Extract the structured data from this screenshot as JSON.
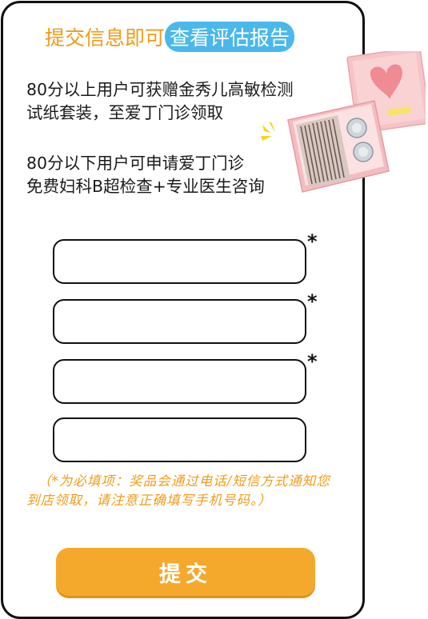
{
  "header": {
    "title_plain": "提交信息即可",
    "title_highlight": "查看评估报告"
  },
  "info": {
    "para1_line1": "80分以上用户可获赠金秀儿高敏检测",
    "para1_line2": "试纸套装，至爱丁门诊领取",
    "para2_line1": "80分以下用户可申请爱丁门诊",
    "para2_line2": "免费妇科B超检查+专业医生咨询"
  },
  "form": {
    "required_mark": "*",
    "fields": [
      {
        "value": "",
        "required": true
      },
      {
        "value": "",
        "required": true
      },
      {
        "value": "",
        "required": true
      },
      {
        "value": "",
        "required": false
      }
    ],
    "note": "（*为必填项：奖品会通过电话/短信方式通知您到店领取，请注意正确填写手机号码。）",
    "submit_label": "提交"
  },
  "colors": {
    "accent_orange": "#f29b1a",
    "highlight_blue": "#4ab8ea",
    "button": "#f5a92c",
    "border": "#111111"
  },
  "icons": [
    "product-box-image",
    "sparkle-icon"
  ]
}
